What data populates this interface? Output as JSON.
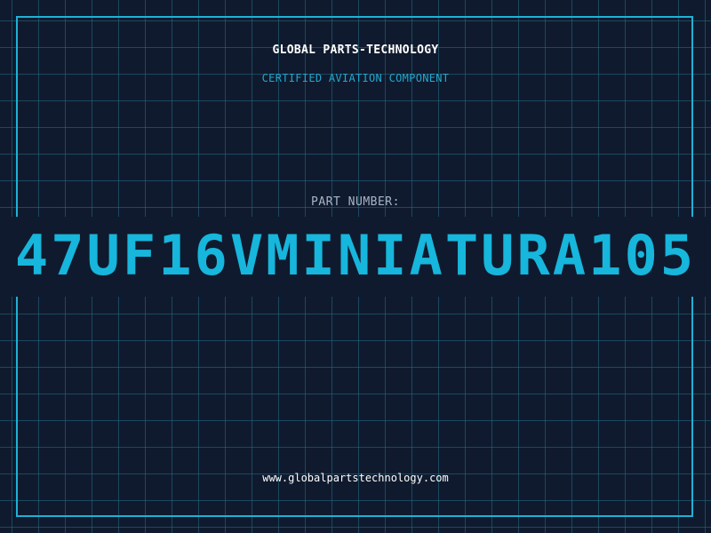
{
  "header": {
    "company": "GLOBAL PARTS-TECHNOLOGY",
    "subtitle": "CERTIFIED AVIATION COMPONENT"
  },
  "part": {
    "label": "PART NUMBER:",
    "value": "47UF16VMINIATURA105"
  },
  "footer": {
    "website": "www.globalpartstechnology.com"
  },
  "colors": {
    "background": "#101a2e",
    "grid": "#256e84",
    "accent": "#1fb1d6",
    "text": "#ffffff"
  }
}
